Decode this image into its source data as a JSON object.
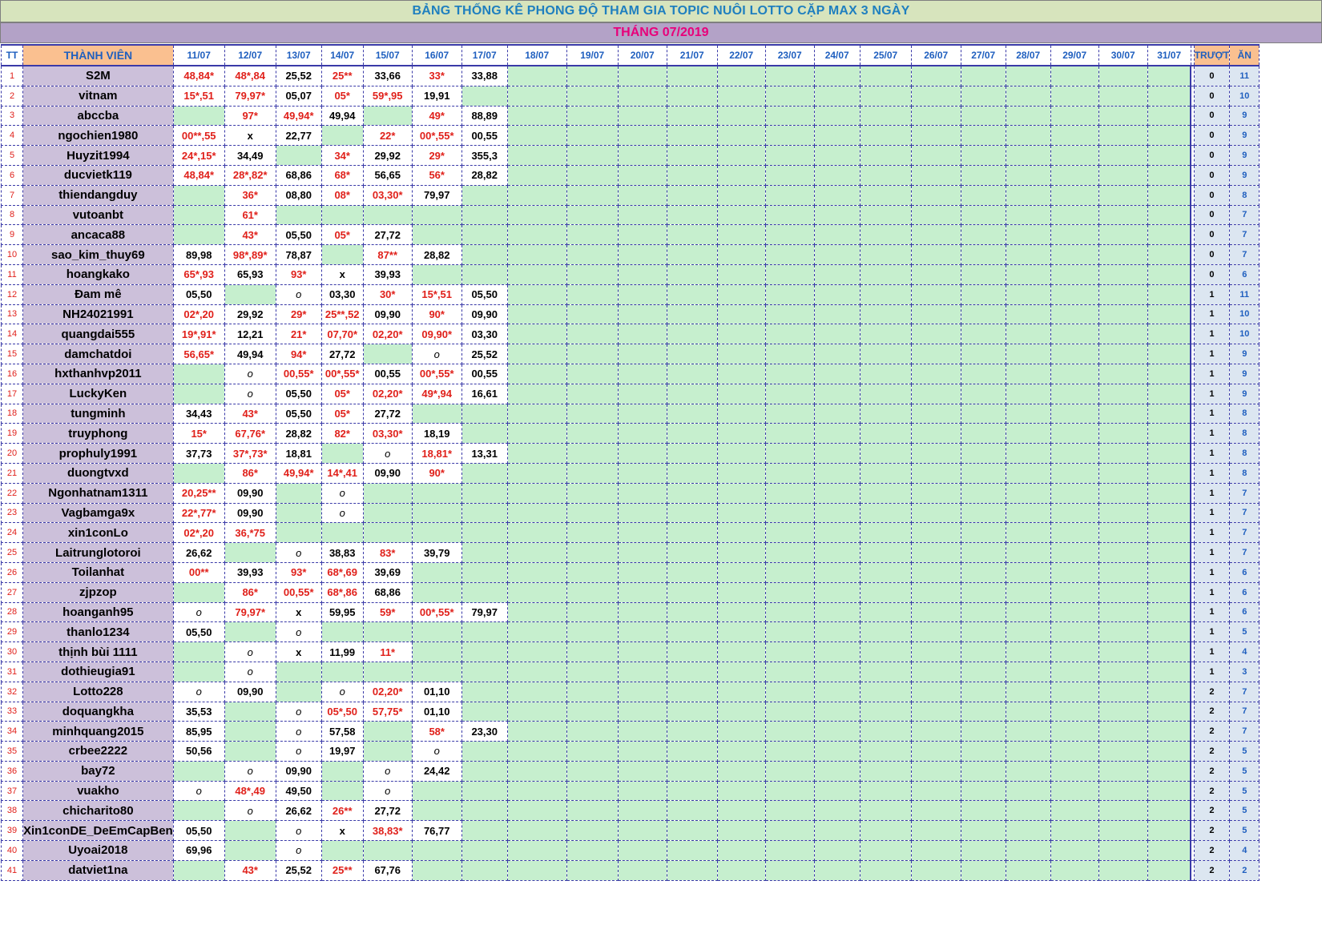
{
  "title": "BẢNG THỐNG KÊ PHONG ĐỘ  THAM GIA TOPIC NUÔI LOTTO CẶP MAX 3 NGÀY",
  "month_label": "THÁNG 07/2019",
  "headers": {
    "tt": "TT",
    "member": "THÀNH VIÊN",
    "days": [
      "11/07",
      "12/07",
      "13/07",
      "14/07",
      "15/07",
      "16/07",
      "17/07",
      "18/07",
      "19/07",
      "20/07",
      "21/07",
      "22/07",
      "23/07",
      "24/07",
      "25/07",
      "26/07",
      "27/07",
      "28/07",
      "29/07",
      "30/07",
      "31/07"
    ],
    "miss": "TRƯỢT",
    "win": "ĂN"
  },
  "colors": {
    "title_bg": "#d7e4bd",
    "title_text": "#1f7fbf",
    "month_bg": "#b3a2c7",
    "month_text": "#e8007a",
    "member_header_bg": "#fac090",
    "name_cell_bg": "#ccc0da",
    "empty_day_bg": "#c6efce",
    "hit_text": "#e0201a",
    "grid_line": "#3a3aa8"
  },
  "rows": [
    {
      "tt": "1",
      "name": "S2M",
      "color": "brown",
      "days": [
        "48,84*",
        "48*,84",
        "25,52",
        "25**",
        "33,66",
        "33*",
        "33,88"
      ],
      "miss": "0",
      "win": "11"
    },
    {
      "tt": "2",
      "name": "vitnam",
      "color": "brown",
      "days": [
        "15*,51",
        "79,97*",
        "05,07",
        "05*",
        "59*,95",
        "19,91",
        ""
      ],
      "miss": "0",
      "win": "10"
    },
    {
      "tt": "3",
      "name": "abccba",
      "color": "yellow",
      "days": [
        "",
        "97*",
        "49,94*",
        "49,94",
        "",
        "49*",
        "88,89"
      ],
      "miss": "0",
      "win": "9"
    },
    {
      "tt": "4",
      "name": "ngochien1980",
      "color": "yellow",
      "days": [
        "00**,55",
        "x",
        "22,77",
        "",
        "22*",
        "00*,55*",
        "00,55"
      ],
      "miss": "0",
      "win": "9"
    },
    {
      "tt": "5",
      "name": "Huyzit1994",
      "color": "brown",
      "days": [
        "24*,15*",
        "34,49",
        "",
        "34*",
        "29,92",
        "29*",
        "355,3"
      ],
      "miss": "0",
      "win": "9"
    },
    {
      "tt": "6",
      "name": "ducvietk119",
      "color": "brown",
      "days": [
        "48,84*",
        "28*,82*",
        "68,86",
        "68*",
        "56,65",
        "56*",
        "28,82"
      ],
      "miss": "0",
      "win": "9"
    },
    {
      "tt": "7",
      "name": "thiendangduy",
      "color": "blue",
      "days": [
        "",
        "36*",
        "08,80",
        "08*",
        "03,30*",
        "79,97",
        ""
      ],
      "miss": "0",
      "win": "8"
    },
    {
      "tt": "8",
      "name": "vutoanbt",
      "color": "brown",
      "days": [
        "",
        "61*",
        "",
        "",
        "",
        "",
        ""
      ],
      "miss": "0",
      "win": "7"
    },
    {
      "tt": "9",
      "name": "ancaca88",
      "color": "brown",
      "days": [
        "",
        "43*",
        "05,50",
        "05*",
        "27,72",
        "",
        ""
      ],
      "miss": "0",
      "win": "7"
    },
    {
      "tt": "10",
      "name": "sao_kim_thuy69",
      "color": "black",
      "days": [
        "89,98",
        "98*,89*",
        "78,87",
        "",
        "87**",
        "28,82",
        ""
      ],
      "miss": "0",
      "win": "7"
    },
    {
      "tt": "11",
      "name": "hoangkako",
      "color": "brown",
      "days": [
        "65*,93",
        "65,93",
        "93*",
        "x",
        "39,93",
        "",
        ""
      ],
      "miss": "0",
      "win": "6"
    },
    {
      "tt": "12",
      "name": "Đam mê",
      "color": "brown",
      "days": [
        "05,50",
        "",
        "o",
        "03,30",
        "30*",
        "15*,51",
        "05,50"
      ],
      "miss": "1",
      "win": "11"
    },
    {
      "tt": "13",
      "name": "NH24021991",
      "color": "brown",
      "days": [
        "02*,20",
        "29,92",
        "29*",
        "25**,52",
        "09,90",
        "90*",
        "09,90"
      ],
      "miss": "1",
      "win": "10"
    },
    {
      "tt": "14",
      "name": "quangdai555",
      "color": "brown",
      "days": [
        "19*,91*",
        "12,21",
        "21*",
        "07,70*",
        "02,20*",
        "09,90*",
        "03,30"
      ],
      "miss": "1",
      "win": "10"
    },
    {
      "tt": "15",
      "name": "damchatdoi",
      "color": "brown",
      "days": [
        "56,65*",
        "49,94",
        "94*",
        "27,72",
        "",
        "o",
        "25,52"
      ],
      "miss": "1",
      "win": "9"
    },
    {
      "tt": "16",
      "name": "hxthanhvp2011",
      "color": "brown",
      "days": [
        "",
        "o",
        "00,55*",
        "00*,55*",
        "00,55",
        "00*,55*",
        "00,55"
      ],
      "miss": "1",
      "win": "9"
    },
    {
      "tt": "17",
      "name": "LuckyKen",
      "color": "brown",
      "days": [
        "",
        "o",
        "05,50",
        "05*",
        "02,20*",
        "49*,94",
        "16,61"
      ],
      "miss": "1",
      "win": "9"
    },
    {
      "tt": "18",
      "name": "tungminh",
      "color": "brown",
      "days": [
        "34,43",
        "43*",
        "05,50",
        "05*",
        "27,72",
        "",
        ""
      ],
      "miss": "1",
      "win": "8"
    },
    {
      "tt": "19",
      "name": "truyphong",
      "color": "black",
      "days": [
        "15*",
        "67,76*",
        "28,82",
        "82*",
        "03,30*",
        "18,19",
        ""
      ],
      "miss": "1",
      "win": "8"
    },
    {
      "tt": "20",
      "name": "prophuly1991",
      "color": "brown",
      "days": [
        "37,73",
        "37*,73*",
        "18,81",
        "",
        "o",
        "18,81*",
        "13,31"
      ],
      "miss": "1",
      "win": "8"
    },
    {
      "tt": "21",
      "name": "duongtvxd",
      "color": "brown",
      "days": [
        "",
        "86*",
        "49,94*",
        "14*,41",
        "09,90",
        "90*",
        ""
      ],
      "miss": "1",
      "win": "8"
    },
    {
      "tt": "22",
      "name": "Ngonhatnam1311",
      "color": "brown",
      "days": [
        "20,25**",
        "09,90",
        "",
        "o",
        "",
        "",
        ""
      ],
      "miss": "1",
      "win": "7"
    },
    {
      "tt": "23",
      "name": "Vagbamga9x",
      "color": "brown",
      "days": [
        "22*,77*",
        "09,90",
        "",
        "o",
        "",
        "",
        ""
      ],
      "miss": "1",
      "win": "7"
    },
    {
      "tt": "24",
      "name": "xin1conLo",
      "color": "brown",
      "days": [
        "02*,20",
        "36,*75",
        "",
        "",
        "",
        "",
        ""
      ],
      "miss": "1",
      "win": "7"
    },
    {
      "tt": "25",
      "name": "Laitrunglotoroi",
      "color": "blue",
      "days": [
        "26,62",
        "",
        "o",
        "38,83",
        "83*",
        "39,79",
        ""
      ],
      "miss": "1",
      "win": "7"
    },
    {
      "tt": "26",
      "name": "Toilanhat",
      "color": "brown",
      "days": [
        "00**",
        "39,93",
        "93*",
        "68*,69",
        "39,69",
        "",
        ""
      ],
      "miss": "1",
      "win": "6"
    },
    {
      "tt": "27",
      "name": "zjpzop",
      "color": "brown",
      "days": [
        "",
        "86*",
        "00,55*",
        "68*,86",
        "68,86",
        "",
        ""
      ],
      "miss": "1",
      "win": "6"
    },
    {
      "tt": "28",
      "name": "hoanganh95",
      "color": "blue",
      "days": [
        "o",
        "79,97*",
        "x",
        "59,95",
        "59*",
        "00*,55*",
        "79,97"
      ],
      "miss": "1",
      "win": "6"
    },
    {
      "tt": "29",
      "name": "thanlo1234",
      "color": "blue",
      "days": [
        "05,50",
        "",
        "o",
        "",
        "",
        "",
        ""
      ],
      "miss": "1",
      "win": "5"
    },
    {
      "tt": "30",
      "name": "thịnh bùi 1111",
      "color": "brown",
      "days": [
        "",
        "o",
        "x",
        "11,99",
        "11*",
        "",
        ""
      ],
      "miss": "1",
      "win": "4"
    },
    {
      "tt": "31",
      "name": "dothieugia91",
      "color": "blue",
      "days": [
        "",
        "o",
        "",
        "",
        "",
        "",
        ""
      ],
      "miss": "1",
      "win": "3"
    },
    {
      "tt": "32",
      "name": "Lotto228",
      "color": "brown",
      "days": [
        "o",
        "09,90",
        "",
        "o",
        "02,20*",
        "01,10",
        ""
      ],
      "miss": "2",
      "win": "7"
    },
    {
      "tt": "33",
      "name": "doquangkha",
      "color": "black",
      "days": [
        "35,53",
        "",
        "o",
        "05*,50",
        "57,75*",
        "01,10",
        ""
      ],
      "miss": "2",
      "win": "7"
    },
    {
      "tt": "34",
      "name": "minhquang2015",
      "color": "blue",
      "days": [
        "85,95",
        "",
        "o",
        "57,58",
        "",
        "58*",
        "23,30"
      ],
      "miss": "2",
      "win": "7"
    },
    {
      "tt": "35",
      "name": "crbee2222",
      "color": "brown",
      "days": [
        "50,56",
        "",
        "o",
        "19,97",
        "",
        "o",
        ""
      ],
      "miss": "2",
      "win": "5"
    },
    {
      "tt": "36",
      "name": "bay72",
      "color": "brown",
      "days": [
        "",
        "o",
        "09,90",
        "",
        "o",
        "24,42",
        ""
      ],
      "miss": "2",
      "win": "5"
    },
    {
      "tt": "37",
      "name": "vuakho",
      "color": "brown",
      "days": [
        "o",
        "48*,49",
        "49,50",
        "",
        "o",
        "",
        ""
      ],
      "miss": "2",
      "win": "5"
    },
    {
      "tt": "38",
      "name": "chicharito80",
      "color": "black",
      "days": [
        "",
        "o",
        "26,62",
        "26**",
        "27,72",
        "",
        ""
      ],
      "miss": "2",
      "win": "5"
    },
    {
      "tt": "39",
      "name": "Xin1conDE_DeEmCapBen",
      "color": "brown",
      "days": [
        "05,50",
        "",
        "o",
        "x",
        "38,83*",
        "76,77",
        ""
      ],
      "miss": "2",
      "win": "5"
    },
    {
      "tt": "40",
      "name": "Uyoai2018",
      "color": "brown",
      "days": [
        "69,96",
        "",
        "o",
        "",
        "",
        "",
        ""
      ],
      "miss": "2",
      "win": "4"
    },
    {
      "tt": "41",
      "name": "datviet1na",
      "color": "brown",
      "days": [
        "",
        "43*",
        "25,52",
        "25**",
        "67,76",
        "",
        ""
      ],
      "miss": "2",
      "win": "2"
    }
  ]
}
